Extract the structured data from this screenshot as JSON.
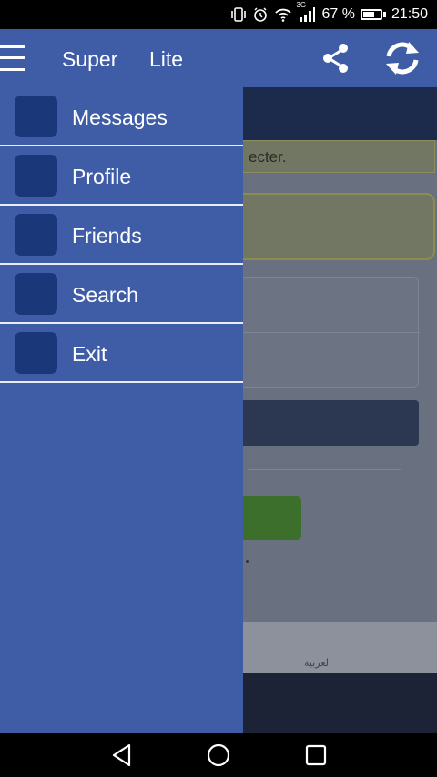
{
  "status_bar": {
    "icons": [
      "vibrate-icon",
      "alarm-icon",
      "wifi-icon",
      "signal-icon"
    ],
    "network_type": "3G",
    "battery_text": "67 %",
    "battery_level": 0.67,
    "time": "21:50"
  },
  "app_bar": {
    "title_left": "Super",
    "title_right": "Lite",
    "actions": [
      "share-icon",
      "refresh-icon"
    ],
    "color": "#3f5ca7"
  },
  "background_page": {
    "notice_text": "ecter.",
    "footer_text": "العربية"
  },
  "drawer": {
    "items": [
      {
        "label": "Messages"
      },
      {
        "label": "Profile"
      },
      {
        "label": "Friends"
      },
      {
        "label": "Search"
      },
      {
        "label": "Exit"
      }
    ],
    "background_color": "#3f5ca7",
    "icon_color": "#1a3879"
  },
  "nav_bar": {
    "buttons": [
      "back-icon",
      "home-icon",
      "recents-icon"
    ]
  }
}
